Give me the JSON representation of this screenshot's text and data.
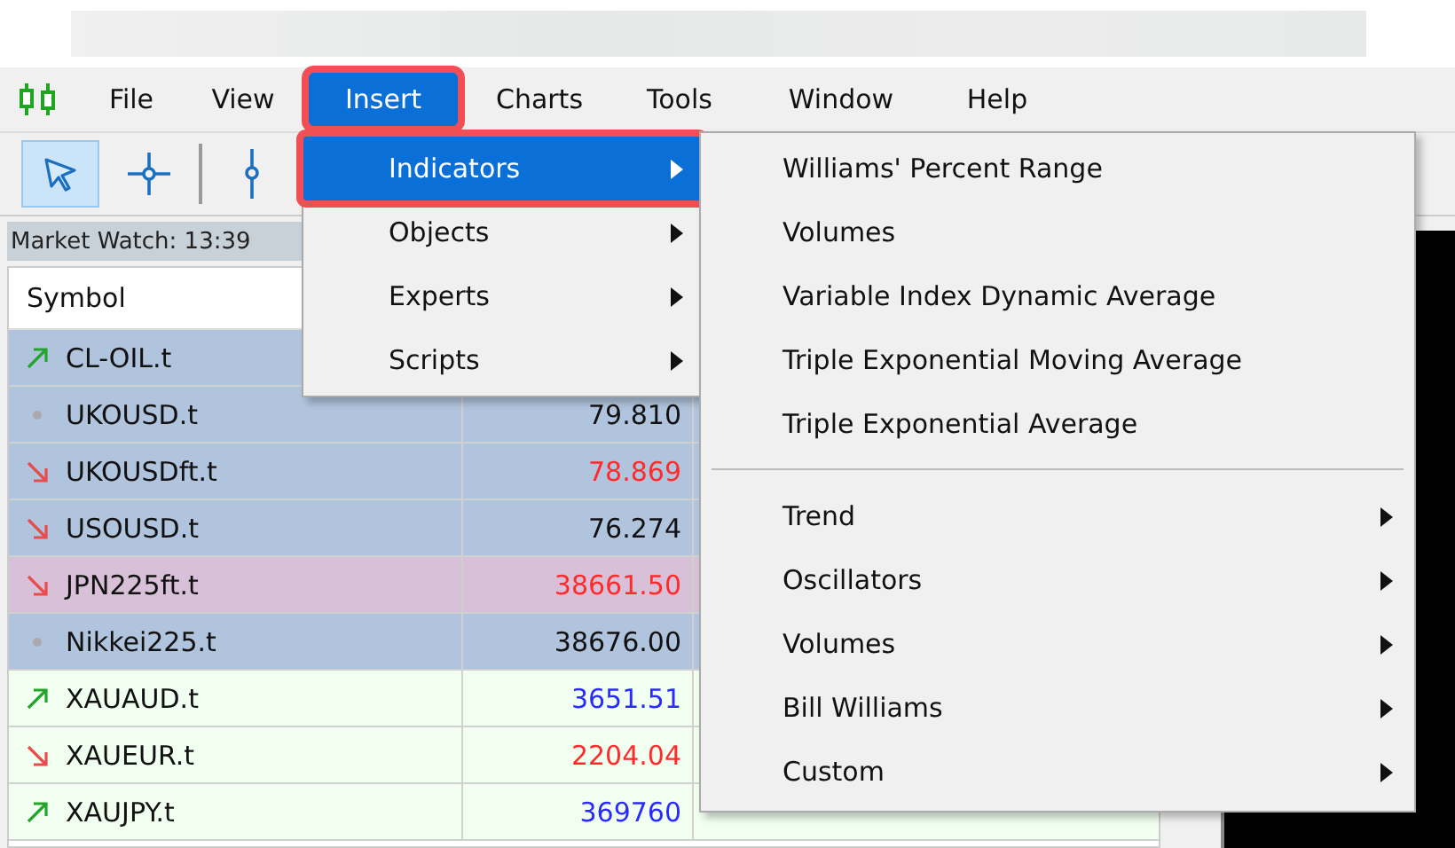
{
  "menu_bar": [
    {
      "label": "File",
      "selected": false
    },
    {
      "label": "View",
      "selected": false
    },
    {
      "label": "Insert",
      "selected": true
    },
    {
      "label": "Charts",
      "selected": false
    },
    {
      "label": "Tools",
      "selected": false
    },
    {
      "label": "Window",
      "selected": false
    },
    {
      "label": "Help",
      "selected": false
    }
  ],
  "toolbar": [
    {
      "kind": "cursor",
      "selected": true
    },
    {
      "kind": "crosshair",
      "selected": false
    },
    {
      "kind": "separator"
    },
    {
      "kind": "vline",
      "selected": false
    }
  ],
  "market_watch": {
    "title": "Market Watch: 13:39",
    "columns": [
      "Symbol"
    ],
    "rows": [
      {
        "symbol": "CL-OIL.t",
        "kind": "up",
        "color": "#b0c4de"
      },
      {
        "symbol": "UKOUSD.t",
        "bid": {
          "text": "79.810",
          "color": "#111111"
        },
        "kind": "flat",
        "color": "#b0c4de"
      },
      {
        "symbol": "UKOUSDft.t",
        "bid": {
          "text": "78.869",
          "color": "#ff2a2a"
        },
        "kind": "down",
        "color": "#b0c4de"
      },
      {
        "symbol": "USOUSD.t",
        "bid": {
          "text": "76.274",
          "color": "#111111"
        },
        "kind": "down",
        "color": "#b0c4de"
      },
      {
        "symbol": "JPN225ft.t",
        "bid": {
          "text": "38661.50",
          "color": "#ff2a2a"
        },
        "kind": "down",
        "color": "#d8c0d8"
      },
      {
        "symbol": "Nikkei225.t",
        "bid": {
          "text": "38676.00",
          "color": "#111111"
        },
        "kind": "flat",
        "color": "#b0c4de"
      },
      {
        "symbol": "XAUAUD.t",
        "bid": {
          "text": "3651.51",
          "color": "#2a2aff"
        },
        "kind": "up",
        "color": "#f0fff0"
      },
      {
        "symbol": "XAUEUR.t",
        "bid": {
          "text": "2204.04",
          "color": "#ff2a2a"
        },
        "kind": "down",
        "color": "#f0fff0"
      },
      {
        "symbol": "XAUJPY.t",
        "bid": {
          "text": "369760",
          "color": "#2a2aff"
        },
        "kind": "up",
        "color": "#f0fff0"
      }
    ]
  },
  "insert_menu": [
    {
      "label": "Indicators",
      "selected": true
    },
    {
      "label": "Objects",
      "selected": false
    },
    {
      "label": "Experts",
      "selected": false
    },
    {
      "label": "Scripts",
      "selected": false
    }
  ],
  "indicators_menu": [
    {
      "label": "Williams' Percent Range",
      "kind": "item"
    },
    {
      "label": "Volumes",
      "kind": "item"
    },
    {
      "label": "Variable Index Dynamic Average",
      "kind": "item"
    },
    {
      "label": "Triple Exponential Moving Average",
      "kind": "item"
    },
    {
      "label": "Triple Exponential Average",
      "kind": "item"
    },
    {
      "kind": "separator"
    },
    {
      "label": "Trend",
      "kind": "submenu"
    },
    {
      "label": "Oscillators",
      "kind": "submenu"
    },
    {
      "label": "Volumes",
      "kind": "submenu"
    },
    {
      "label": "Bill Williams",
      "kind": "submenu"
    },
    {
      "label": "Custom",
      "kind": "submenu"
    }
  ]
}
